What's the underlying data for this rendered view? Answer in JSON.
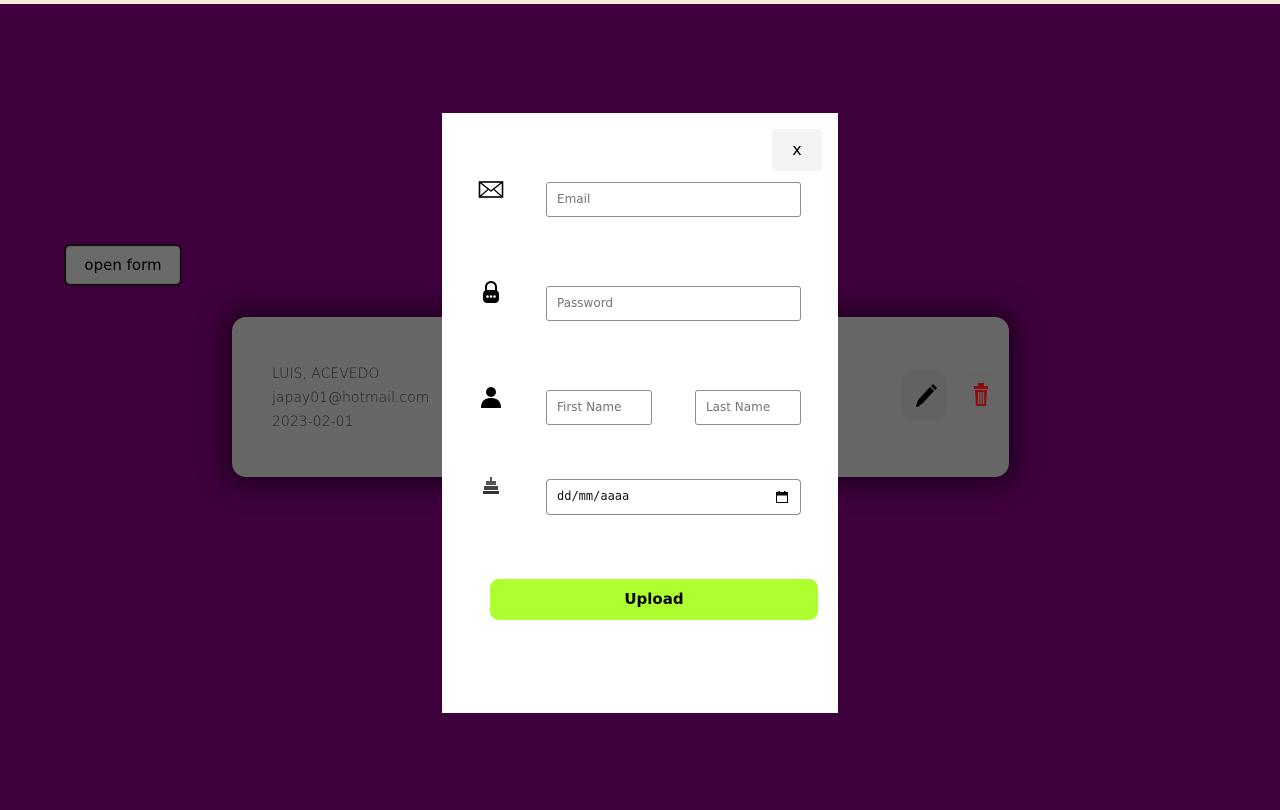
{
  "page": {
    "background_color": "#3f003e",
    "accent_color": "#adff2f"
  },
  "open_form_button": {
    "label": "open form"
  },
  "user_card": {
    "name": "LUIS, ACEVEDO",
    "email": "japay01@hotmail.com",
    "date": "2023-02-01",
    "edit_icon": "pencil-icon",
    "delete_icon": "trash-icon",
    "delete_color": "#8b0d0d"
  },
  "modal": {
    "close_label": "x",
    "email": {
      "icon": "envelope-icon",
      "placeholder": "Email",
      "value": ""
    },
    "password": {
      "icon": "lock-icon",
      "placeholder": "Password",
      "value": ""
    },
    "name": {
      "icon": "person-icon",
      "first_placeholder": "First Name",
      "last_placeholder": "Last Name"
    },
    "birthdate": {
      "icon": "cake-icon",
      "display": "dd/mm/aaaa"
    },
    "upload_label": "Upload"
  }
}
